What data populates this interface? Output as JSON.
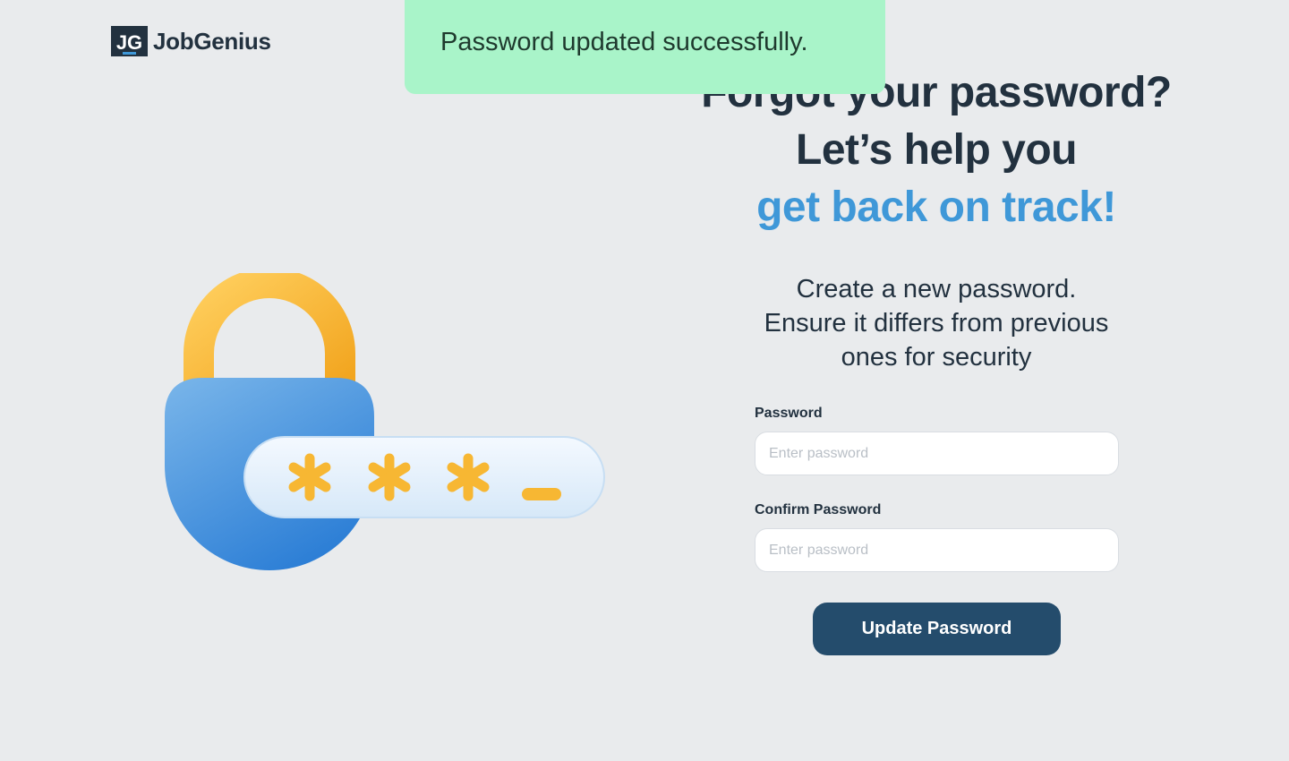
{
  "brand": {
    "logo_text": "JG",
    "name": "JobGenius"
  },
  "hero": {
    "line1": "Forgot your password?",
    "line2": "Let’s help you",
    "line3": "get back on track!"
  },
  "subtext": {
    "line1": "Create a new password.",
    "line2": "Ensure it differs from previous",
    "line3": "ones for security"
  },
  "form": {
    "password_label": "Password",
    "password_placeholder": "Enter password",
    "password_value": "",
    "confirm_label": "Confirm Password",
    "confirm_placeholder": "Enter password",
    "confirm_value": "",
    "submit_label": "Update Password"
  },
  "toast": {
    "message": "Password updated successfully."
  },
  "illustration": {
    "icon": "lock-password-icon"
  },
  "colors": {
    "background": "#e9ebed",
    "primary_text": "#22313f",
    "accent": "#3f98d8",
    "button": "#244c6c",
    "toast_bg": "#a9f4c9"
  }
}
